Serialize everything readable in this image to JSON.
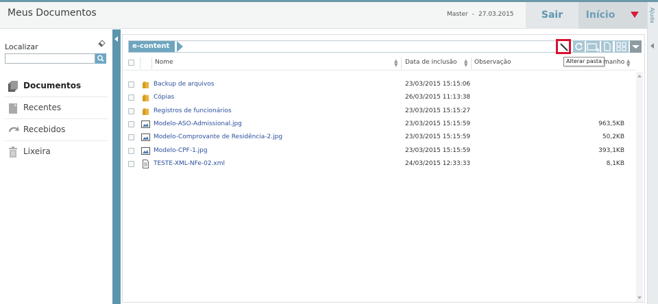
{
  "header": {
    "title": "Meus Documentos",
    "user": "Master",
    "separator": "-",
    "date": "27.03.2015",
    "logout_label": "Sair",
    "home_label": "Início",
    "help_label": "Ajuda",
    "menu_arrow_color": "#d9193a"
  },
  "sidebar": {
    "search_label": "Localizar",
    "search_value": "",
    "items": [
      {
        "label": "Documentos",
        "icon": "documents-icon",
        "active": true
      },
      {
        "label": "Recentes",
        "icon": "recent-icon",
        "active": false
      },
      {
        "label": "Recebidos",
        "icon": "received-icon",
        "active": false
      },
      {
        "label": "Lixeira",
        "icon": "trash-icon",
        "active": false
      }
    ]
  },
  "main": {
    "breadcrumb": "e-content",
    "tooltip": "Alterar pasta",
    "toolbar": [
      "rename-folder-icon",
      "refresh-icon",
      "new-folder-icon",
      "upload-icon",
      "grid-view-icon",
      "dropdown-icon"
    ],
    "columns": {
      "name": "Nome",
      "date": "Data de inclusão",
      "note": "Observação",
      "size": "manho"
    },
    "rows": [
      {
        "name": "Backup de arquivos",
        "date": "23/03/2015 15:15:06",
        "size": "",
        "type": "folder"
      },
      {
        "name": "Cópias",
        "date": "26/03/2015 11:13:38",
        "size": "",
        "type": "folder"
      },
      {
        "name": "Registros de funcionários",
        "date": "23/03/2015 15:15:27",
        "size": "",
        "type": "folder"
      },
      {
        "name": "Modelo-ASO-Admissional.jpg",
        "date": "23/03/2015 15:15:59",
        "size": "963,5KB",
        "type": "image"
      },
      {
        "name": "Modelo-Comprovante de Residência-2.jpg",
        "date": "23/03/2015 15:15:59",
        "size": "50,2KB",
        "type": "image"
      },
      {
        "name": "Modelo-CPF-1.jpg",
        "date": "23/03/2015 15:15:59",
        "size": "393,1KB",
        "type": "image"
      },
      {
        "name": "TESTE-XML-NFe-02.xml",
        "date": "24/03/2015 12:33:33",
        "size": "8,1KB",
        "type": "document"
      }
    ]
  }
}
